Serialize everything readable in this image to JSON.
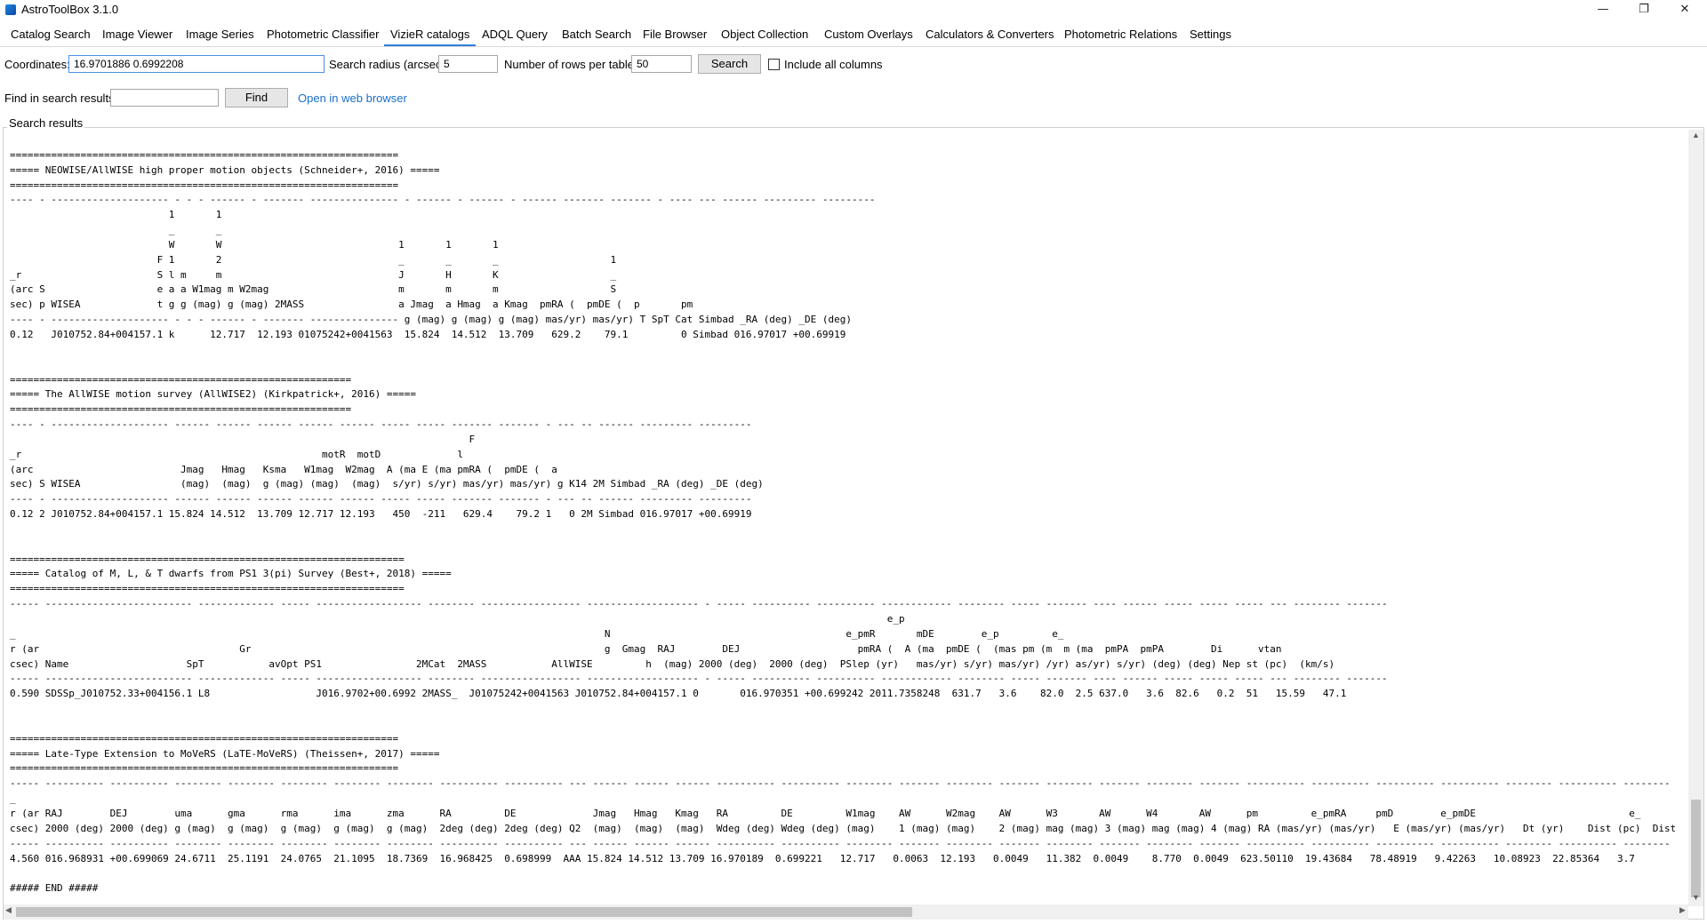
{
  "window": {
    "title": "AstroToolBox 3.1.0",
    "minimize_glyph": "—",
    "maximize_glyph": "❐",
    "close_glyph": "✕"
  },
  "tabs": [
    {
      "label": "Catalog Search"
    },
    {
      "label": "Image Viewer"
    },
    {
      "label": "Image Series"
    },
    {
      "label": "Photometric Classifier"
    },
    {
      "label": "VizieR catalogs",
      "active": true
    },
    {
      "label": "ADQL Query"
    },
    {
      "label": "Batch Search"
    },
    {
      "label": "File Browser"
    },
    {
      "label": "Object Collection"
    },
    {
      "label": "Custom Overlays"
    },
    {
      "label": "Calculators & Converters"
    },
    {
      "label": "Photometric Relations"
    },
    {
      "label": "Settings"
    }
  ],
  "search": {
    "coordinates_label": "Coordinates:",
    "coordinates_value": "16.9701886 0.6992208",
    "radius_label": "Search radius (arcsec):",
    "radius_value": "5",
    "rows_label": "Number of rows per table:",
    "rows_value": "50",
    "search_button": "Search",
    "include_all_label": "Include all columns",
    "include_all_checked": false
  },
  "find": {
    "label": "Find in search results:",
    "value": "",
    "button": "Find",
    "web_link": "Open in web browser"
  },
  "results": {
    "group_title": "Search results",
    "lines": [
      "",
      "==================================================================",
      "===== NEOWISE/AllWISE high proper motion objects (Schneider+, 2016) =====",
      "==================================================================",
      "---- - -------------------- - - - ------ - ------- --------------- - ------ - ------ - ------ ------- ------- - ---- --- ------ --------- ---------",
      "                           1       1",
      "                           _       _",
      "                           W       W                              1       1       1",
      "                         F 1       2                              _       _       _                   1",
      "_r                       S l m     m                              J       H       K                   _",
      "(arc S                   e a a W1mag m W2mag                      m       m       m                   S",
      "sec) p WISEA             t g g (mag) g (mag) 2MASS                a Jmag  a Hmag  a Kmag  pmRA (  pmDE (  p       pm",
      "---- - -------------------- - - - ------ - ------- --------------- g (mag) g (mag) g (mag) mas/yr) mas/yr) T SpT Cat Simbad _RA (deg) _DE (deg)",
      "0.12   J010752.84+004157.1 k      12.717  12.193 01075242+0041563  15.824  14.512  13.709   629.2    79.1         0 Simbad 016.97017 +00.69919",
      "",
      "",
      "==========================================================",
      "===== The AllWISE motion survey (AllWISE2) (Kirkpatrick+, 2016) =====",
      "==========================================================",
      "---- - -------------------- ------ ------ ------ ------ ------ ----- ----- ------- ------- - --- -- ------ --------- ---------",
      "                                                                              F",
      "_r                                                   motR  motD             l",
      "(arc                         Jmag   Hmag   Ksma   W1mag  W2mag  A (ma E (ma pmRA (  pmDE (  a",
      "sec) S WISEA                 (mag)  (mag)  g (mag) (mag)  (mag)  s/yr) s/yr) mas/yr) mas/yr) g K14 2M Simbad _RA (deg) _DE (deg)",
      "---- - -------------------- ------ ------ ------ ------ ------ ----- ----- ------- ------- - --- -- ------ --------- ---------",
      "0.12 2 J010752.84+004157.1 15.824 14.512  13.709 12.717 12.193   450  -211   629.4    79.2 1   0 2M Simbad 016.97017 +00.69919",
      "",
      "",
      "===================================================================",
      "===== Catalog of M, L, & T dwarfs from PS1 3(pi) Survey (Best+, 2018) =====",
      "===================================================================",
      "----- ------------------------- ------------- ----- ------------------ -------- ----------------- ------------------- - ----- ---------- ---------- ------------ -------- ----- ------- ---- ------ ----- ----- ----- --- -------- -------",
      "                                                                                                                                                     e_p",
      "_                                                                                                    N                                        e_pmR       mDE        e_p         e_",
      "r (ar                                  Gr                                                            g  Gmag  RAJ        DEJ                    pmRA (  A (ma  pmDE (  (mas pm (m  m (ma  pmPA  pmPA        Di      vtan",
      "csec) Name                    SpT           avOpt PS1                2MCat  2MASS           AllWISE         h  (mag) 2000 (deg)  2000 (deg)  PSlep (yr)   mas/yr) s/yr) mas/yr) /yr) as/yr) s/yr) (deg) (deg) Nep st (pc)  (km/s)",
      "----- ------------------------- ------------- ----- ------------------ -------- ----------------- ------------------- - ----- ---------- ---------- ------------ -------- ----- ------- ---- ------ ----- ----- ----- --- -------- -------",
      "0.590 SDSSp_J010752.33+004156.1 L8                  J016.9702+00.6992 2MASS_  J01075242+0041563 J010752.84+004157.1 0       016.970351 +00.699242 2011.7358248  631.7   3.6    82.0  2.5 637.0   3.6  82.6   0.2  51   15.59   47.1",
      "",
      "",
      "==================================================================",
      "===== Late-Type Extension to MoVeRS (LaTE-MoVeRS) (Theissen+, 2017) =====",
      "==================================================================",
      "----- ---------- ---------- -------- -------- -------- -------- -------- ---------- ---------- --- ------ ------ ------ ---------- ---------- -------- ------- -------- ------- -------- ------- -------- ------- ---------- ---------- ---------- ---------- -------- ---------- --------",
      "_",
      "r (ar RAJ        DEJ        uma      gma      rma      ima      zma      RA         DE             Jmag   Hmag   Kmag   RA         DE         W1mag    AW      W2mag    AW      W3       AW      W4       AW      pm         e_pmRA     pmD        e_pmDE                          e_",
      "csec) 2000 (deg) 2000 (deg) g (mag)  g (mag)  g (mag)  g (mag)  g (mag)  2deg (deg) 2deg (deg) Q2  (mag)  (mag)  (mag)  Wdeg (deg) Wdeg (deg) (mag)    1 (mag) (mag)    2 (mag) mag (mag) 3 (mag) mag (mag) 4 (mag) RA (mas/yr) (mas/yr)   E (mas/yr) (mas/yr)   Dt (yr)    Dist (pc)  Dist",
      "----- ---------- ---------- -------- -------- -------- -------- -------- ---------- ---------- --- ------ ------ ------ ---------- ---------- -------- ------- -------- ------- -------- ------- -------- ------- ---------- ---------- ---------- ---------- -------- ---------- --------",
      "4.560 016.968931 +00.699069 24.6711  25.1191  24.0765  21.1095  18.7369  16.968425  0.698999  AAA 15.824 14.512 13.709 16.970189  0.699221   12.717   0.0063  12.193   0.0049   11.382  0.0049    8.770  0.0049  623.50110  19.43684   78.48919   9.42263   10.08923  22.85364   3.7",
      "",
      "##### END #####"
    ]
  }
}
